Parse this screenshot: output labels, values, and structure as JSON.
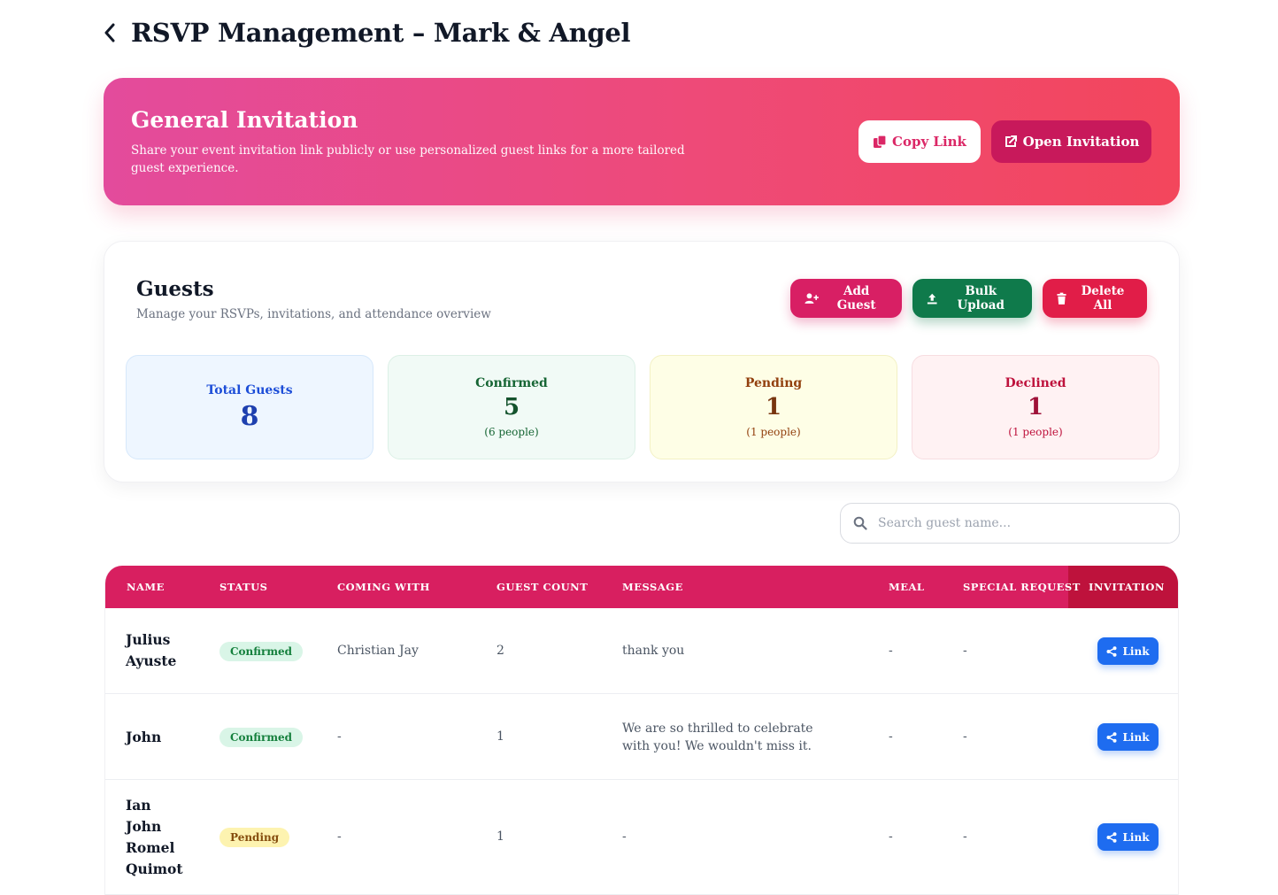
{
  "header": {
    "title": "RSVP Management – Mark & Angel"
  },
  "hero": {
    "title": "General Invitation",
    "description": "Share your event invitation link publicly or use personalized guest links for a more tailored guest experience.",
    "copy_label": "Copy Link",
    "open_label": "Open Invitation"
  },
  "guests": {
    "title": "Guests",
    "subtitle": "Manage your RSVPs, invitations, and attendance overview",
    "add_label": "Add Guest",
    "bulk_label": "Bulk Upload",
    "delete_label": "Delete All"
  },
  "stats": {
    "total": {
      "label": "Total Guests",
      "value": "8"
    },
    "confirmed": {
      "label": "Confirmed",
      "value": "5",
      "sub": "(6 people)"
    },
    "pending": {
      "label": "Pending",
      "value": "1",
      "sub": "(1 people)"
    },
    "declined": {
      "label": "Declined",
      "value": "1",
      "sub": "(1 people)"
    }
  },
  "search": {
    "placeholder": "Search guest name..."
  },
  "table": {
    "columns": [
      "NAME",
      "STATUS",
      "COMING WITH",
      "GUEST COUNT",
      "MESSAGE",
      "MEAL",
      "SPECIAL REQUEST",
      "INVITATION"
    ],
    "link_label": "Link",
    "rows": [
      {
        "name": "Julius Ayuste",
        "status": "Confirmed",
        "coming_with": "Christian Jay",
        "guest_count": "2",
        "message": "thank you",
        "meal": "-",
        "special_request": "-"
      },
      {
        "name": "John",
        "status": "Confirmed",
        "coming_with": "-",
        "guest_count": "1",
        "message": "We are so thrilled to celebrate with you! We wouldn't miss it.",
        "meal": "-",
        "special_request": "-"
      },
      {
        "name": "Ian John Romel Quimot",
        "status": "Pending",
        "coming_with": "-",
        "guest_count": "1",
        "message": "-",
        "meal": "-",
        "special_request": "-"
      }
    ]
  },
  "colors": {
    "accent": "#d81f60",
    "link_blue": "#1e6cf0",
    "confirmed_green": "#15803d",
    "pending_amber": "#854d0e"
  }
}
